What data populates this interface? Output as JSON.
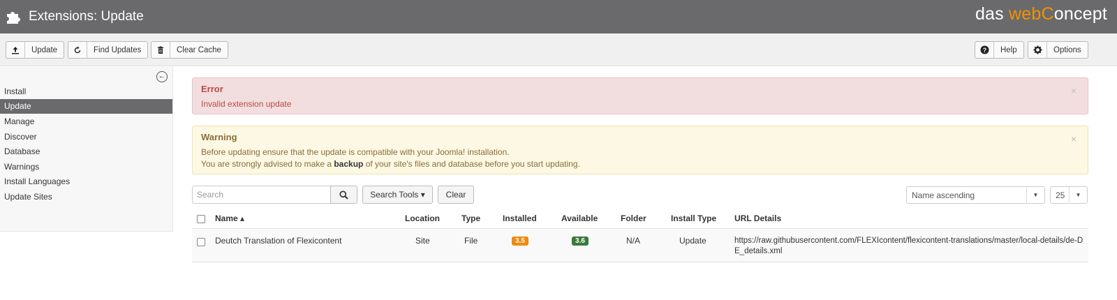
{
  "header": {
    "title": "Extensions: Update",
    "brand": {
      "part1": "das ",
      "part2": "web",
      "part3": "C",
      "part4": "oncept"
    },
    "puzzle_icon": "puzzle-icon"
  },
  "toolbar": {
    "update_label": "Update",
    "find_updates_label": "Find Updates",
    "clear_cache_label": "Clear Cache",
    "help_label": "Help",
    "options_label": "Options",
    "icons": {
      "update": "upload-icon",
      "find": "refresh-icon",
      "clear": "trash-icon",
      "help": "question-icon",
      "options": "gear-icon"
    }
  },
  "sidebar": {
    "collapse_icon": "arrow-left-circle-icon",
    "items": [
      {
        "label": "Install",
        "active": false
      },
      {
        "label": "Update",
        "active": true
      },
      {
        "label": "Manage",
        "active": false
      },
      {
        "label": "Discover",
        "active": false
      },
      {
        "label": "Database",
        "active": false
      },
      {
        "label": "Warnings",
        "active": false
      },
      {
        "label": "Install Languages",
        "active": false
      },
      {
        "label": "Update Sites",
        "active": false
      }
    ]
  },
  "alerts": {
    "error": {
      "title": "Error",
      "message": "Invalid extension update",
      "close": "×",
      "color": "#b94a48"
    },
    "warning": {
      "title": "Warning",
      "line1": "Before updating ensure that the update is compatible with your Joomla! installation.",
      "line2_pre": "You are strongly advised to make a ",
      "line2_bold": "backup",
      "line2_post": " of your site's files and database before you start updating.",
      "close": "×",
      "color": "#8a6d3b"
    }
  },
  "filters": {
    "search_placeholder": "Search",
    "search_tools_label": "Search Tools ▾",
    "clear_label": "Clear",
    "ordering_value": "Name ascending",
    "limit_value": "25"
  },
  "table": {
    "columns": {
      "name": "Name ▴",
      "location": "Location",
      "type": "Type",
      "installed": "Installed",
      "available": "Available",
      "folder": "Folder",
      "install_type": "Install Type",
      "url_details": "URL Details"
    },
    "rows": [
      {
        "name": "Deutch Translation of Flexicontent",
        "location": "Site",
        "type": "File",
        "installed": "3.5",
        "available": "3.6",
        "folder": "N/A",
        "install_type": "Update",
        "url": "https://raw.githubusercontent.com/FLEXIcontent/flexicontent-translations/master/local-details/de-DE_details.xml"
      }
    ],
    "colors": {
      "installed_badge": "#f0890c",
      "available_badge": "#3a7a3a"
    }
  }
}
